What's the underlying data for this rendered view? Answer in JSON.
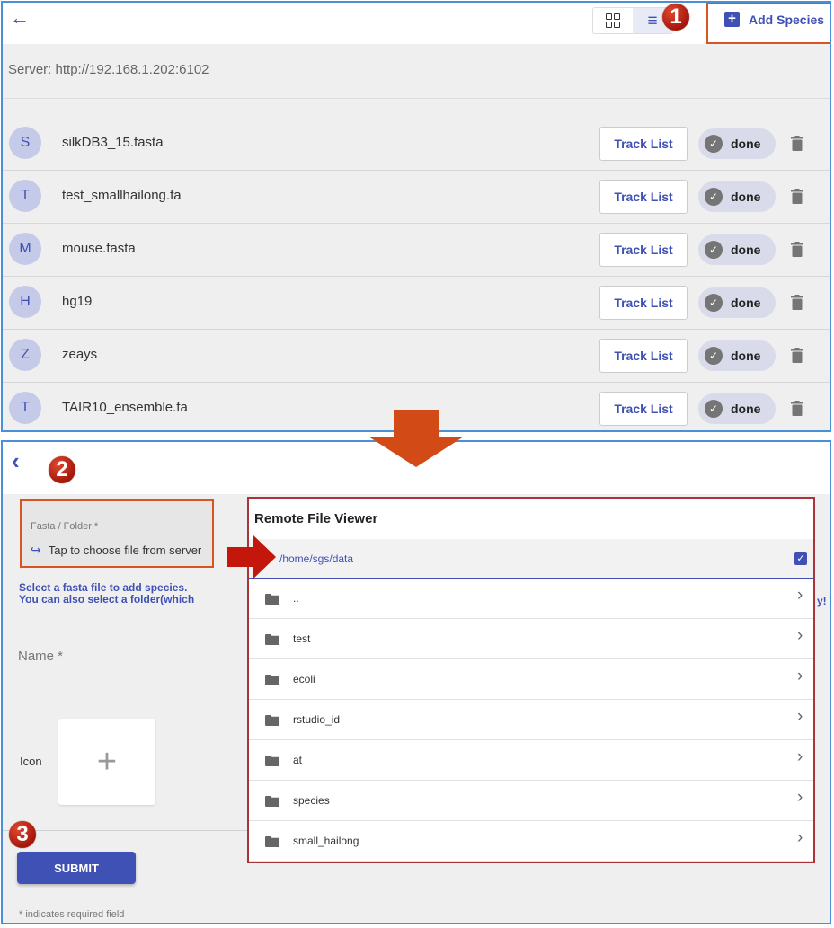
{
  "panel1": {
    "back_icon": "arrow-left-icon",
    "view_toggle": {
      "grid_icon": "grid-view-icon",
      "list_icon": "list-view-icon",
      "active": "list"
    },
    "add_species_label": "Add Species",
    "server_text": "Server: http://192.168.1.202:6102",
    "species": [
      {
        "initial": "S",
        "name": "silkDB3_15.fasta",
        "track_label": "Track List",
        "status": "done"
      },
      {
        "initial": "T",
        "name": "test_smallhailong.fa",
        "track_label": "Track List",
        "status": "done"
      },
      {
        "initial": "M",
        "name": "mouse.fasta",
        "track_label": "Track List",
        "status": "done"
      },
      {
        "initial": "H",
        "name": "hg19",
        "track_label": "Track List",
        "status": "done"
      },
      {
        "initial": "Z",
        "name": "zeays",
        "track_label": "Track List",
        "status": "done"
      },
      {
        "initial": "T",
        "name": "TAIR10_ensemble.fa",
        "track_label": "Track List",
        "status": "done"
      }
    ]
  },
  "callouts": {
    "step1": "1",
    "step2": "2",
    "step3": "3"
  },
  "panel2": {
    "fasta_label": "Fasta / Folder *",
    "fasta_placeholder": "Tap to choose file from server",
    "hint_line1": "Select a fasta file to add species.",
    "hint_line2": "You can also select a folder(which",
    "hint_tail": "y!",
    "name_label": "Name *",
    "icon_label": "Icon",
    "icon_tile_symbol": "+",
    "submit_label": "SUBMIT",
    "required_note": "* indicates required field"
  },
  "file_viewer": {
    "title": "Remote File Viewer",
    "path": "/home/sgs/data",
    "items": [
      "..",
      "test",
      "ecoli",
      "rstudio_id",
      "at",
      "species",
      "small_hailong"
    ]
  },
  "colors": {
    "primary": "#3f51b5",
    "callout_border": "#d9541e",
    "viewer_border": "#a9353a",
    "badge_red": "#c0210f"
  }
}
